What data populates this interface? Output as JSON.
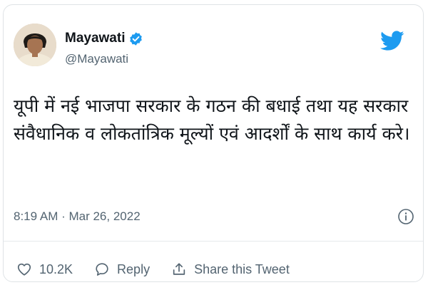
{
  "tweet": {
    "author_name": "Mayawati",
    "handle": "@Mayawati",
    "verified": true,
    "text": "यूपी में नई भाजपा सरकार के गठन की बधाई तथा यह सरकार  संवैधानिक व लोकतांत्रिक मूल्यों एवं आदर्शों के साथ कार्य करे।",
    "timestamp": "8:19 AM · Mar 26, 2022",
    "like_count": "10.2K",
    "reply_label": "Reply",
    "share_label": "Share this Tweet"
  },
  "colors": {
    "brand_blue": "#1d9bf0",
    "secondary_text": "#536471",
    "primary_text": "#0f1419"
  },
  "icons": {
    "brand": "twitter-bird-icon",
    "verified": "verified-badge-icon",
    "info": "info-icon",
    "like": "heart-icon",
    "reply": "speech-bubble-icon",
    "share": "share-upload-icon"
  }
}
